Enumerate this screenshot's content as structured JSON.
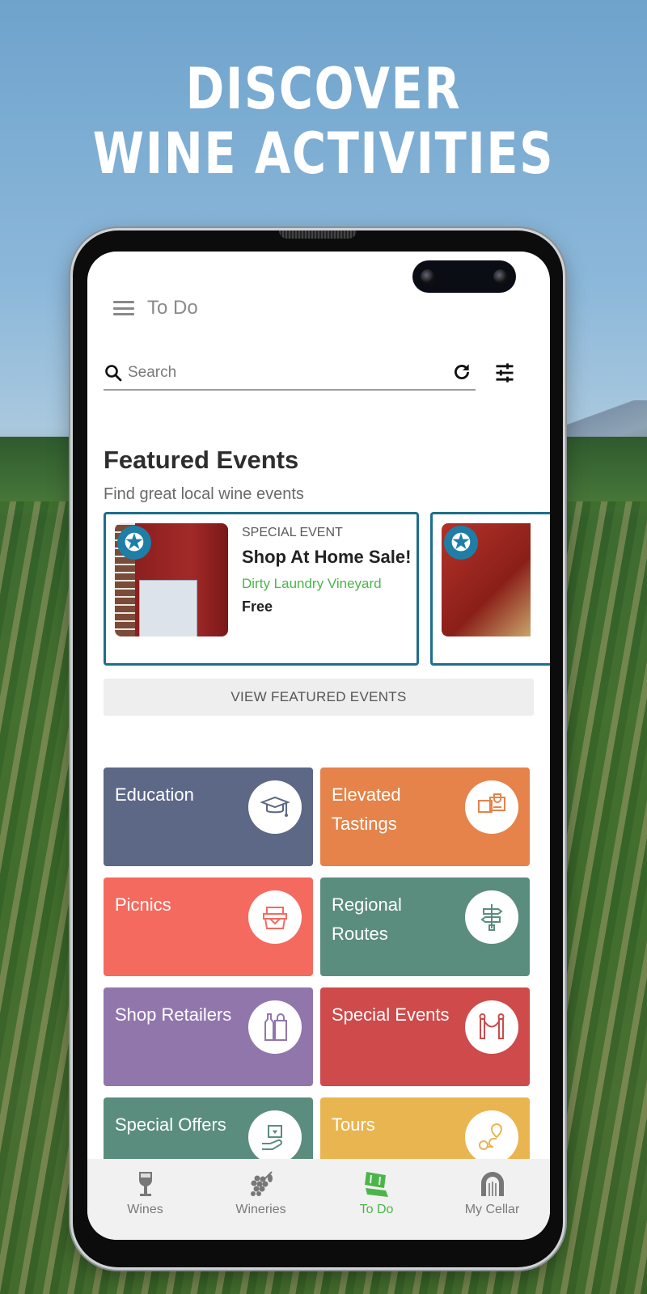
{
  "hero": {
    "line1": "DISCOVER",
    "line2": "WINE ACTIVITIES"
  },
  "app": {
    "title": "To Do",
    "search": {
      "placeholder": "Search",
      "value": ""
    },
    "featured": {
      "heading": "Featured Events",
      "subheading": "Find great local wine events",
      "events": [
        {
          "category": "SPECIAL EVENT",
          "name": "Shop At Home Sale!",
          "venue": "Dirty Laundry Vineyard",
          "price": "Free"
        }
      ],
      "view_button": "VIEW FEATURED EVENTS"
    },
    "categories": [
      {
        "label": "Education",
        "color": "#5d6786",
        "icon": "graduation-cap-icon"
      },
      {
        "label": "Elevated Tastings",
        "color": "#e5834a",
        "icon": "tasting-chat-icon"
      },
      {
        "label": "Picnics",
        "color": "#f56a5e",
        "icon": "picnic-basket-icon"
      },
      {
        "label": "Regional Routes",
        "color": "#5b8d7e",
        "icon": "signpost-icon"
      },
      {
        "label": "Shop Retailers",
        "color": "#9176ac",
        "icon": "bottle-bag-icon"
      },
      {
        "label": "Special Events",
        "color": "#cf4a4a",
        "icon": "velvet-rope-icon"
      },
      {
        "label": "Special Offers",
        "color": "#5b8d7e",
        "icon": "gift-hand-icon"
      },
      {
        "label": "Tours",
        "color": "#e9b550",
        "icon": "route-pin-icon"
      }
    ],
    "tabs": [
      {
        "label": "Wines",
        "icon": "wine-glass-icon",
        "active": false
      },
      {
        "label": "Wineries",
        "icon": "grapes-icon",
        "active": false
      },
      {
        "label": "To Do",
        "icon": "tickets-icon",
        "active": true
      },
      {
        "label": "My Cellar",
        "icon": "cellar-icon",
        "active": false
      }
    ],
    "colors": {
      "accent": "#4cb54a",
      "card_border": "#1d6f8a"
    }
  }
}
